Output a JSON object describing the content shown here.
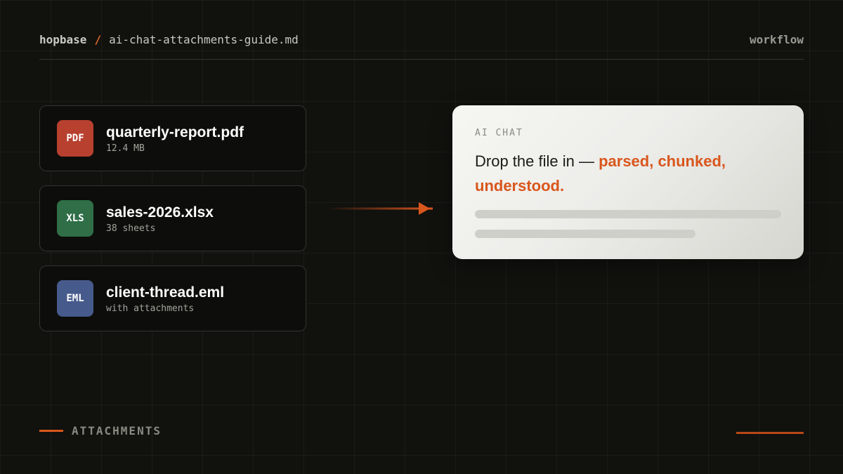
{
  "header": {
    "breadcrumb_root": "hopbase",
    "breadcrumb_separator": "/",
    "breadcrumb_file": "ai-chat-attachments-guide.md",
    "tag": "workflow"
  },
  "files": [
    {
      "badge": "PDF",
      "name": "quarterly-report.pdf",
      "meta": "12.4 MB",
      "color": "#b8402f"
    },
    {
      "badge": "XLS",
      "name": "sales-2026.xlsx",
      "meta": "38 sheets",
      "color": "#2f6e47"
    },
    {
      "badge": "EML",
      "name": "client-thread.eml",
      "meta": "with attachments",
      "color": "#465a8c"
    }
  ],
  "chat": {
    "label": "AI CHAT",
    "text_plain": "Drop the file in — ",
    "text_highlight": "parsed, chunked, understood."
  },
  "footer": {
    "label": "ATTACHMENTS"
  },
  "colors": {
    "accent": "#d9561c",
    "background": "#11110e"
  },
  "icons": {
    "flow_arrow": "arrow-right-icon"
  }
}
